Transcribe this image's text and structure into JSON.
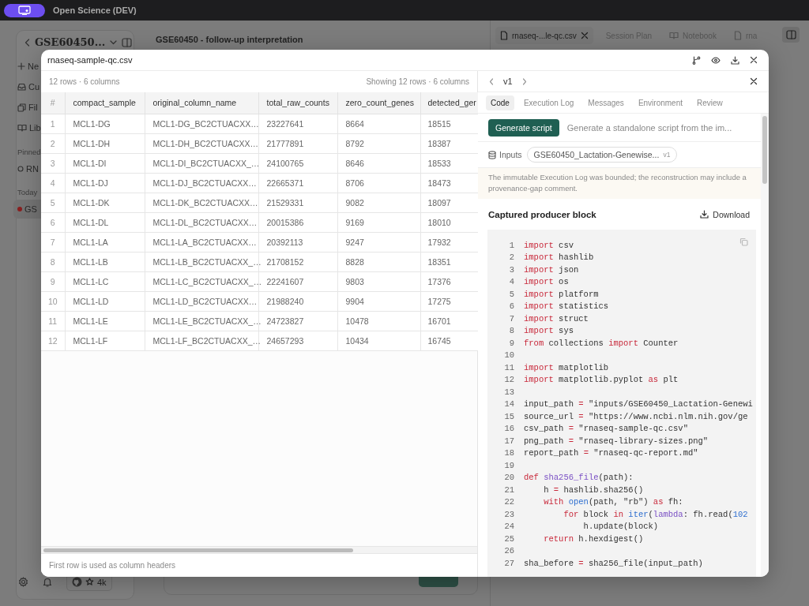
{
  "top_bar": {
    "title": "Open Science (DEV)"
  },
  "sidebar": {
    "title": "GSE60450...",
    "nav_items": [
      {
        "label": "Ne",
        "kind": "new"
      },
      {
        "label": "Cu",
        "kind": "curate"
      },
      {
        "label": "Fil",
        "kind": "files"
      },
      {
        "label": "Lib",
        "kind": "library"
      }
    ],
    "sections": [
      {
        "heading": "Pinned",
        "items": [
          {
            "label": "RN",
            "kind": "pinned",
            "selected": false
          }
        ]
      },
      {
        "heading": "Today",
        "items": [
          {
            "label": "GS",
            "kind": "recent",
            "selected": true
          }
        ]
      }
    ],
    "footer": {
      "star_count": "4k"
    }
  },
  "main": {
    "title": "GSE60450 - follow-up interpretation",
    "tabs": [
      {
        "label": "rnaseq-...le-qc.csv",
        "kind": "file",
        "selected": true
      },
      {
        "label": "Session Plan",
        "kind": "plain",
        "selected": false
      },
      {
        "label": "Notebook",
        "kind": "notebook",
        "selected": false
      },
      {
        "label": "rna",
        "kind": "file",
        "selected": false
      }
    ]
  },
  "modal": {
    "title": "rnaseq-sample-qc.csv",
    "table_panel": {
      "summary": "12 rows · 6 columns",
      "showing": "Showing 12 rows · 6 columns",
      "columns": [
        "#",
        "compact_sample",
        "original_column_name",
        "total_raw_counts",
        "zero_count_genes",
        "detected_ger"
      ],
      "rows": [
        [
          "1",
          "MCL1-DG",
          "MCL1-DG_BC2CTUACXX…",
          "23227641",
          "8664",
          "18515"
        ],
        [
          "2",
          "MCL1-DH",
          "MCL1-DH_BC2CTUACXX…",
          "21777891",
          "8792",
          "18387"
        ],
        [
          "3",
          "MCL1-DI",
          "MCL1-DI_BC2CTUACXX_…",
          "24100765",
          "8646",
          "18533"
        ],
        [
          "4",
          "MCL1-DJ",
          "MCL1-DJ_BC2CTUACXX…",
          "22665371",
          "8706",
          "18473"
        ],
        [
          "5",
          "MCL1-DK",
          "MCL1-DK_BC2CTUACXX…",
          "21529331",
          "9082",
          "18097"
        ],
        [
          "6",
          "MCL1-DL",
          "MCL1-DL_BC2CTUACXX…",
          "20015386",
          "9169",
          "18010"
        ],
        [
          "7",
          "MCL1-LA",
          "MCL1-LA_BC2CTUACXX…",
          "20392113",
          "9247",
          "17932"
        ],
        [
          "8",
          "MCL1-LB",
          "MCL1-LB_BC2CTUACXX_…",
          "21708152",
          "8828",
          "18351"
        ],
        [
          "9",
          "MCL1-LC",
          "MCL1-LC_BC2CTUACXX_…",
          "22241607",
          "9803",
          "17376"
        ],
        [
          "10",
          "MCL1-LD",
          "MCL1-LD_BC2CTUACXX…",
          "21988240",
          "9904",
          "17275"
        ],
        [
          "11",
          "MCL1-LE",
          "MCL1-LE_BC2CTUACXX_…",
          "24723827",
          "10478",
          "16701"
        ],
        [
          "12",
          "MCL1-LF",
          "MCL1-LF_BC2CTUACXX_…",
          "24657293",
          "10434",
          "16745"
        ]
      ],
      "footer": "First row is used as column headers"
    },
    "detail_panel": {
      "version": "v1",
      "tabs": [
        {
          "label": "Code",
          "selected": true
        },
        {
          "label": "Execution Log",
          "selected": false
        },
        {
          "label": "Messages",
          "selected": false
        },
        {
          "label": "Environment",
          "selected": false
        },
        {
          "label": "Review",
          "selected": false
        }
      ],
      "generate_button": "Generate script",
      "generate_hint": "Generate a standalone script from the im...",
      "inputs_label": "Inputs",
      "input_chip": {
        "name": "GSE60450_Lactation-Genewise...",
        "version": "v1"
      },
      "notice": "The immutable Execution Log was bounded; the reconstruction may include a provenance-gap comment.",
      "block_title": "Captured producer block",
      "download": "Download",
      "code_lines": [
        {
          "number": "1",
          "tokens": [
            {
              "text": "import",
              "kind": "keyword"
            },
            {
              "text": " csv",
              "kind": "plain"
            }
          ]
        },
        {
          "number": "2",
          "tokens": [
            {
              "text": "import",
              "kind": "keyword"
            },
            {
              "text": " hashlib",
              "kind": "plain"
            }
          ]
        },
        {
          "number": "3",
          "tokens": [
            {
              "text": "import",
              "kind": "keyword"
            },
            {
              "text": " json",
              "kind": "plain"
            }
          ]
        },
        {
          "number": "4",
          "tokens": [
            {
              "text": "import",
              "kind": "keyword"
            },
            {
              "text": " os",
              "kind": "plain"
            }
          ]
        },
        {
          "number": "5",
          "tokens": [
            {
              "text": "import",
              "kind": "keyword"
            },
            {
              "text": " platform",
              "kind": "plain"
            }
          ]
        },
        {
          "number": "6",
          "tokens": [
            {
              "text": "import",
              "kind": "keyword"
            },
            {
              "text": " statistics",
              "kind": "plain"
            }
          ]
        },
        {
          "number": "7",
          "tokens": [
            {
              "text": "import",
              "kind": "keyword"
            },
            {
              "text": " struct",
              "kind": "plain"
            }
          ]
        },
        {
          "number": "8",
          "tokens": [
            {
              "text": "import",
              "kind": "keyword"
            },
            {
              "text": " sys",
              "kind": "plain"
            }
          ]
        },
        {
          "number": "9",
          "tokens": [
            {
              "text": "from",
              "kind": "keyword"
            },
            {
              "text": " collections ",
              "kind": "plain"
            },
            {
              "text": "import",
              "kind": "keyword"
            },
            {
              "text": " Counter",
              "kind": "plain"
            }
          ]
        },
        {
          "number": "10"
        },
        {
          "number": "11",
          "tokens": [
            {
              "text": "import",
              "kind": "keyword"
            },
            {
              "text": " matplotlib",
              "kind": "plain"
            }
          ]
        },
        {
          "number": "12",
          "tokens": [
            {
              "text": "import",
              "kind": "keyword"
            },
            {
              "text": " matplotlib.pyplot ",
              "kind": "plain"
            },
            {
              "text": "as",
              "kind": "keyword"
            },
            {
              "text": " plt",
              "kind": "plain"
            }
          ]
        },
        {
          "number": "13"
        },
        {
          "number": "14",
          "tokens": [
            {
              "text": "input_path ",
              "kind": "plain"
            },
            {
              "text": "=",
              "kind": "operator"
            },
            {
              "text": " \"inputs/GSE60450_Lactation-Genewi",
              "kind": "string"
            }
          ]
        },
        {
          "number": "15",
          "tokens": [
            {
              "text": "source_url ",
              "kind": "plain"
            },
            {
              "text": "=",
              "kind": "operator"
            },
            {
              "text": " \"https://www.ncbi.nlm.nih.gov/ge",
              "kind": "string"
            }
          ]
        },
        {
          "number": "16",
          "tokens": [
            {
              "text": "csv_path ",
              "kind": "plain"
            },
            {
              "text": "=",
              "kind": "operator"
            },
            {
              "text": " \"rnaseq-sample-qc.csv\"",
              "kind": "string"
            }
          ]
        },
        {
          "number": "17",
          "tokens": [
            {
              "text": "png_path ",
              "kind": "plain"
            },
            {
              "text": "=",
              "kind": "operator"
            },
            {
              "text": " \"rnaseq-library-sizes.png\"",
              "kind": "string"
            }
          ]
        },
        {
          "number": "18",
          "tokens": [
            {
              "text": "report_path ",
              "kind": "plain"
            },
            {
              "text": "=",
              "kind": "operator"
            },
            {
              "text": " \"rnaseq-qc-report.md\"",
              "kind": "string"
            }
          ]
        },
        {
          "number": "19"
        },
        {
          "number": "20",
          "tokens": [
            {
              "text": "def ",
              "kind": "keyword"
            },
            {
              "text": "sha256_file",
              "kind": "function"
            },
            {
              "text": "(path):",
              "kind": "plain"
            }
          ]
        },
        {
          "number": "21",
          "tokens": [
            {
              "text": "    h ",
              "kind": "plain"
            },
            {
              "text": "=",
              "kind": "operator"
            },
            {
              "text": " hashlib.sha256()",
              "kind": "plain"
            }
          ]
        },
        {
          "number": "22",
          "tokens": [
            {
              "text": "    with ",
              "kind": "keyword"
            },
            {
              "text": "open",
              "kind": "builtin"
            },
            {
              "text": "(path, \"rb\") ",
              "kind": "plain"
            },
            {
              "text": "as",
              "kind": "keyword"
            },
            {
              "text": " fh:",
              "kind": "plain"
            }
          ]
        },
        {
          "number": "23",
          "tokens": [
            {
              "text": "        for",
              "kind": "keyword"
            },
            {
              "text": " block ",
              "kind": "plain"
            },
            {
              "text": "in ",
              "kind": "keyword"
            },
            {
              "text": "iter",
              "kind": "builtin"
            },
            {
              "text": "(",
              "kind": "plain"
            },
            {
              "text": "lambda",
              "kind": "function"
            },
            {
              "text": ": fh.read(",
              "kind": "plain"
            },
            {
              "text": "102",
              "kind": "number"
            }
          ]
        },
        {
          "number": "24",
          "tokens": [
            {
              "text": "            h.update(block)",
              "kind": "plain"
            }
          ]
        },
        {
          "number": "25",
          "tokens": [
            {
              "text": "    return",
              "kind": "keyword"
            },
            {
              "text": " h.hexdigest()",
              "kind": "plain"
            }
          ]
        },
        {
          "number": "26"
        },
        {
          "number": "27",
          "tokens": [
            {
              "text": "sha_before ",
              "kind": "plain"
            },
            {
              "text": "=",
              "kind": "operator"
            },
            {
              "text": " sha256_file(input_path)",
              "kind": "plain"
            }
          ]
        }
      ]
    }
  }
}
